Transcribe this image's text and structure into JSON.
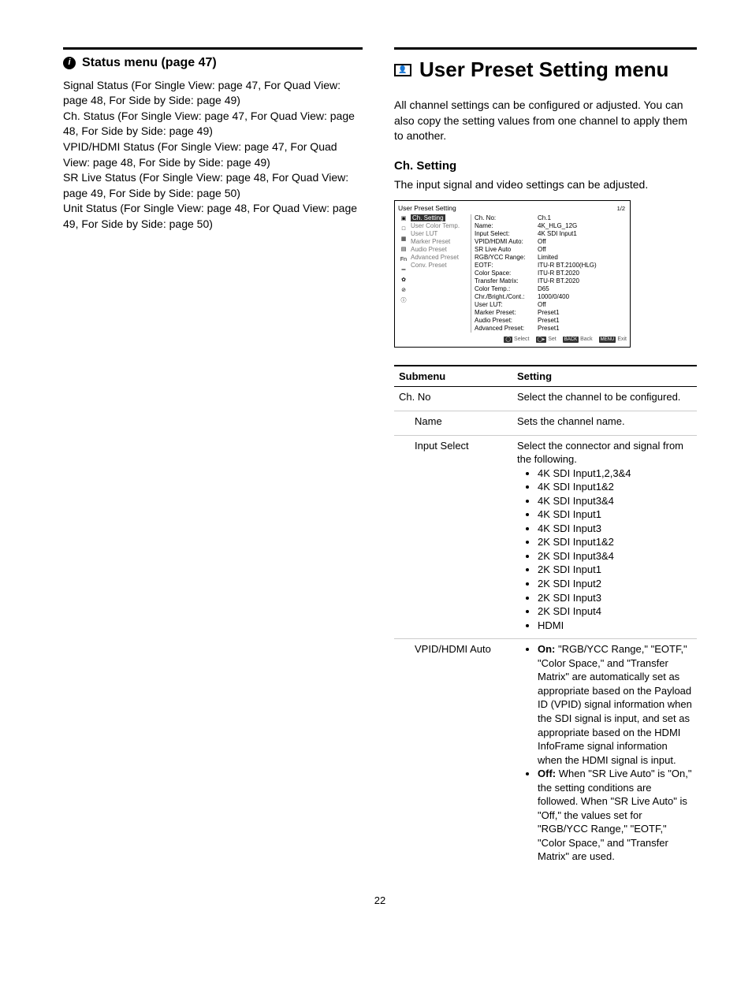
{
  "left": {
    "heading": "Status menu (page 47)",
    "body": "Signal Status (For Single View: page 47, For Quad View: page 48, For Side by Side: page 49)\nCh. Status (For Single View: page 47, For Quad View: page 48, For Side by Side: page 49)\nVPID/HDMI Status (For Single View: page 47, For Quad View: page 48, For Side by Side: page 49)\nSR Live Status (For Single View: page 48, For Quad View: page 49, For Side by Side: page 50)\nUnit Status (For Single View: page 48, For Quad View: page 49, For Side by Side: page 50)"
  },
  "right": {
    "title": "User Preset Setting menu",
    "intro": "All channel settings can be configured or adjusted. You can also copy the setting values from one channel to apply them to another.",
    "section_title": "Ch. Setting",
    "section_desc": "The input signal and video settings can be adjusted."
  },
  "osd": {
    "title": "User Preset Setting",
    "page": "1/2",
    "side_icons": [
      "▣",
      "□",
      "▦",
      "▤",
      "Fn",
      "═",
      "✿",
      "⊘",
      "ⓘ"
    ],
    "menu": [
      {
        "label": "Ch. Setting",
        "active": true
      },
      {
        "label": "User Color Temp.",
        "active": false
      },
      {
        "label": "User LUT",
        "active": false
      },
      {
        "label": "Marker Preset",
        "active": false
      },
      {
        "label": "Audio Preset",
        "active": false
      },
      {
        "label": "Advanced Preset",
        "active": false
      },
      {
        "label": "Conv. Preset",
        "active": false
      }
    ],
    "kv": [
      [
        "Ch. No:",
        "Ch.1"
      ],
      [
        "Name:",
        "4K_HLG_12G"
      ],
      [
        "Input Select:",
        "4K SDI Input1"
      ],
      [
        "VPID/HDMI Auto:",
        "Off"
      ],
      [
        "SR Live Auto",
        "Off"
      ],
      [
        "RGB/YCC Range:",
        "Limited"
      ],
      [
        "EOTF:",
        "ITU-R BT.2100(HLG)"
      ],
      [
        "Color Space:",
        "ITU-R BT.2020"
      ],
      [
        "Transfer Matrix:",
        "ITU-R BT.2020"
      ],
      [
        "Color Temp.:",
        "D65"
      ],
      [
        "Chr./Bright./Cont.:",
        "1000/0/400"
      ],
      [
        "User LUT:",
        "Off"
      ],
      [
        "Marker Preset:",
        "Preset1"
      ],
      [
        "Audio Preset:",
        "Preset1"
      ],
      [
        "Advanced Preset:",
        "Preset1"
      ]
    ],
    "footer": [
      {
        "badge": "◯",
        "label": "Select"
      },
      {
        "badge": "◯▸",
        "label": "Set"
      },
      {
        "badge": "BACK",
        "label": "Back"
      },
      {
        "badge": "MENU",
        "label": "Exit"
      }
    ]
  },
  "table": {
    "headers": [
      "Submenu",
      "Setting"
    ],
    "rows": [
      {
        "sub": "Ch. No",
        "indent": false,
        "setting_text": "Select the channel to be configured."
      },
      {
        "sub": "Name",
        "indent": true,
        "setting_text": "Sets the channel name."
      },
      {
        "sub": "Input Select",
        "indent": true,
        "setting_text": "Select the connector and signal from the following.",
        "options": [
          "4K SDI Input1,2,3&4",
          "4K SDI Input1&2",
          "4K SDI Input3&4",
          "4K SDI Input1",
          "4K SDI Input3",
          "2K SDI Input1&2",
          "2K SDI Input3&4",
          "2K SDI Input1",
          "2K SDI Input2",
          "2K SDI Input3",
          "2K SDI Input4",
          "HDMI"
        ]
      },
      {
        "sub": "VPID/HDMI Auto",
        "indent": true,
        "definitions": [
          {
            "term": "On:",
            "text": "\"RGB/YCC Range,\" \"EOTF,\" \"Color Space,\" and \"Transfer Matrix\" are automatically set as appropriate based on the Payload ID (VPID) signal information when the SDI signal is input, and set as appropriate based on the HDMI InfoFrame signal information when the HDMI signal is input."
          },
          {
            "term": "Off:",
            "text": "When \"SR Live Auto\" is \"On,\" the setting conditions are followed. When \"SR Live Auto\" is \"Off,\" the values set for \"RGB/YCC Range,\" \"EOTF,\" \"Color Space,\" and \"Transfer Matrix\" are used."
          }
        ]
      }
    ]
  },
  "page_number": "22"
}
